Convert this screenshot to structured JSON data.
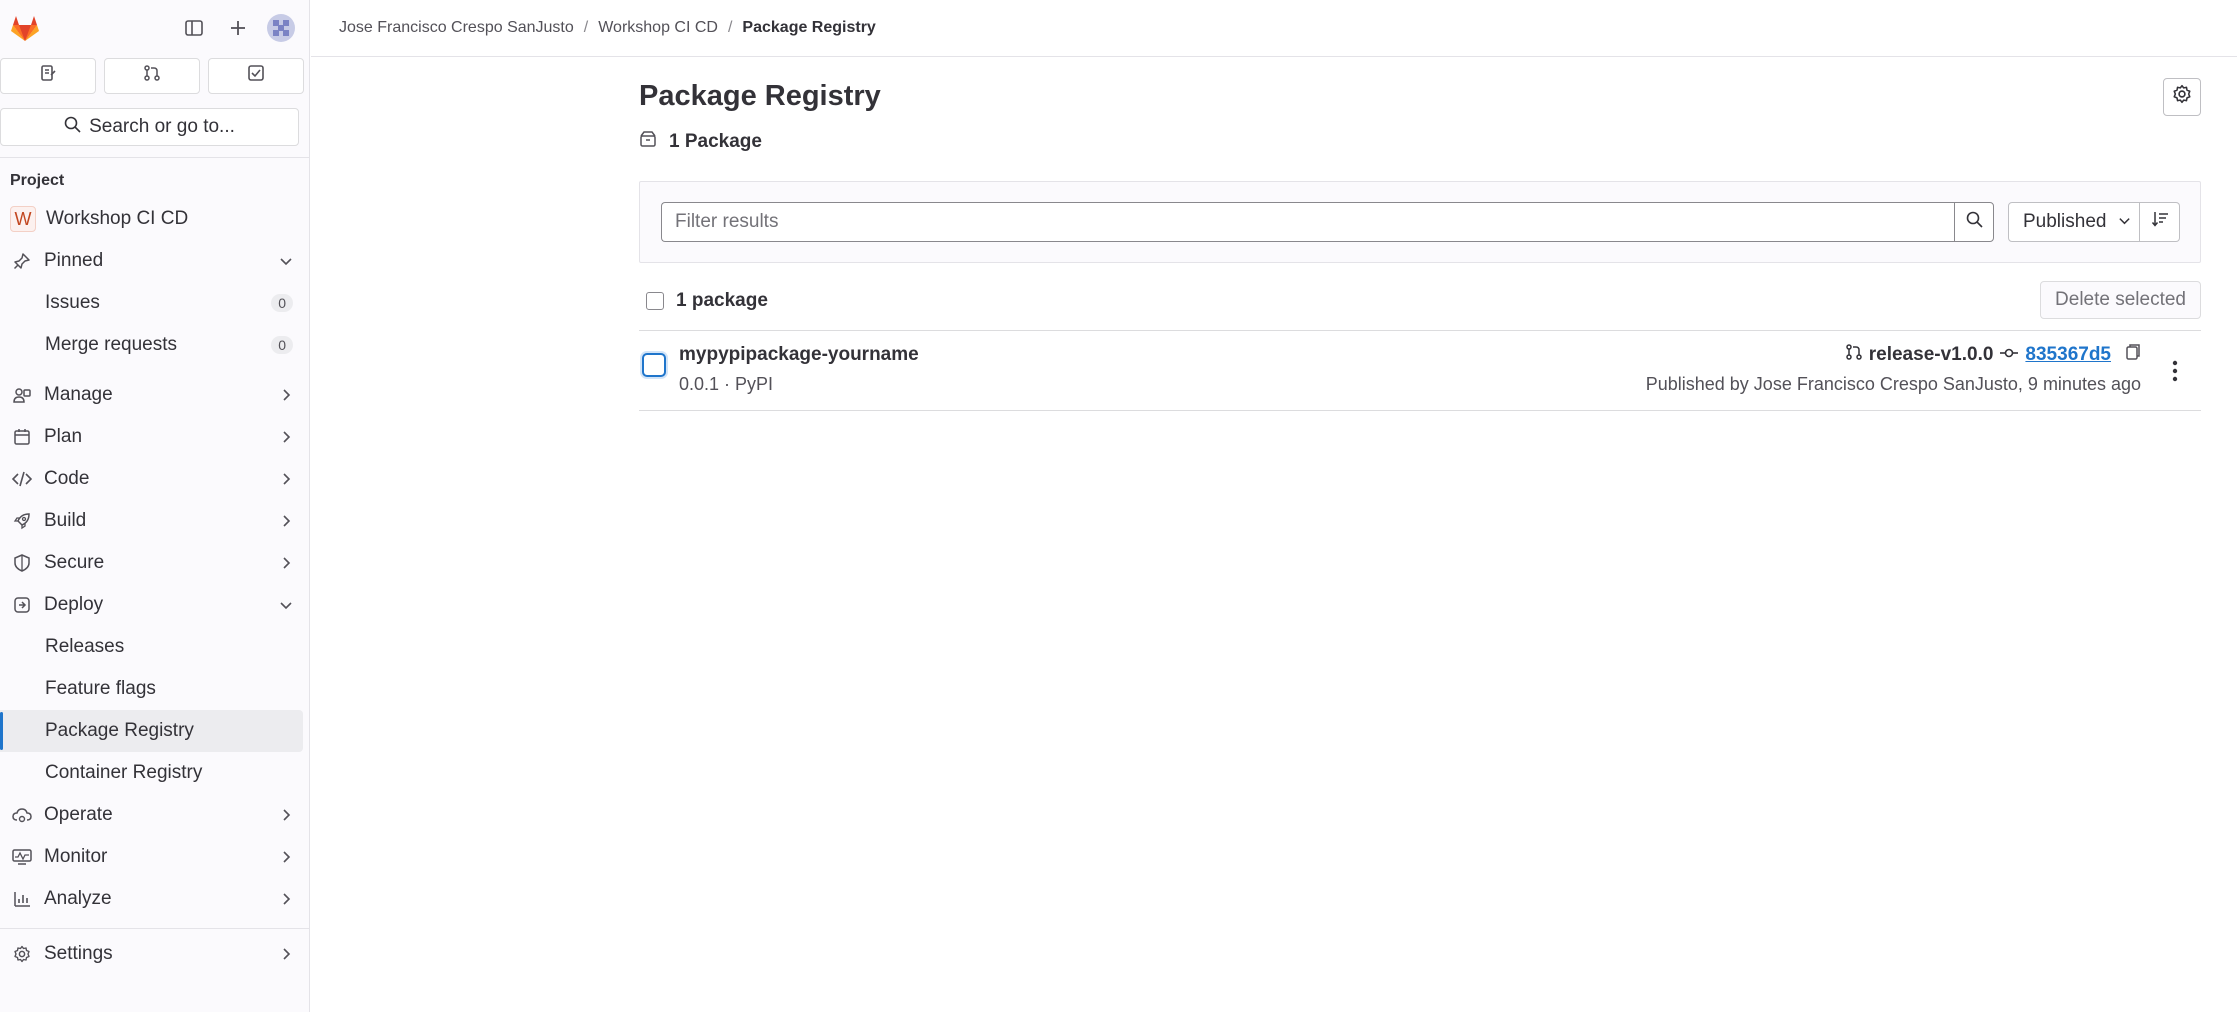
{
  "sidebar": {
    "tabs": [
      {
        "icon": "issues-icon"
      },
      {
        "icon": "merge-request-icon"
      },
      {
        "icon": "todo-icon"
      }
    ],
    "search_label": "Search or go to...",
    "section_title": "Project",
    "project": {
      "badge": "W",
      "name": "Workshop CI CD"
    },
    "pinned": {
      "label": "Pinned",
      "items": [
        {
          "label": "Issues",
          "count": "0"
        },
        {
          "label": "Merge requests",
          "count": "0"
        }
      ]
    },
    "groups": [
      {
        "label": "Manage"
      },
      {
        "label": "Plan"
      },
      {
        "label": "Code"
      },
      {
        "label": "Build"
      },
      {
        "label": "Secure"
      }
    ],
    "deploy": {
      "label": "Deploy",
      "items": [
        {
          "label": "Releases"
        },
        {
          "label": "Feature flags"
        },
        {
          "label": "Package Registry"
        },
        {
          "label": "Container Registry"
        }
      ]
    },
    "groups_after": [
      {
        "label": "Operate"
      },
      {
        "label": "Monitor"
      },
      {
        "label": "Analyze"
      }
    ],
    "settings_label": "Settings"
  },
  "breadcrumb": {
    "items": [
      "Jose Francisco Crespo SanJusto",
      "Workshop CI CD"
    ],
    "current": "Package Registry"
  },
  "main": {
    "title": "Package Registry",
    "package_count": "1 Package",
    "filter_placeholder": "Filter results",
    "sort_label": "Published",
    "list_count_label": "1 package",
    "delete_label": "Delete selected",
    "package": {
      "name": "mypypipackage-yourname",
      "meta": "0.0.1 · PyPI",
      "branch": "release-v1.0.0",
      "commit": "835367d5",
      "published": "Published by Jose Francisco Crespo SanJusto, 9 minutes ago"
    }
  },
  "colors": {
    "accent": "#1f75cb",
    "text": "#333238",
    "muted": "#535158"
  }
}
